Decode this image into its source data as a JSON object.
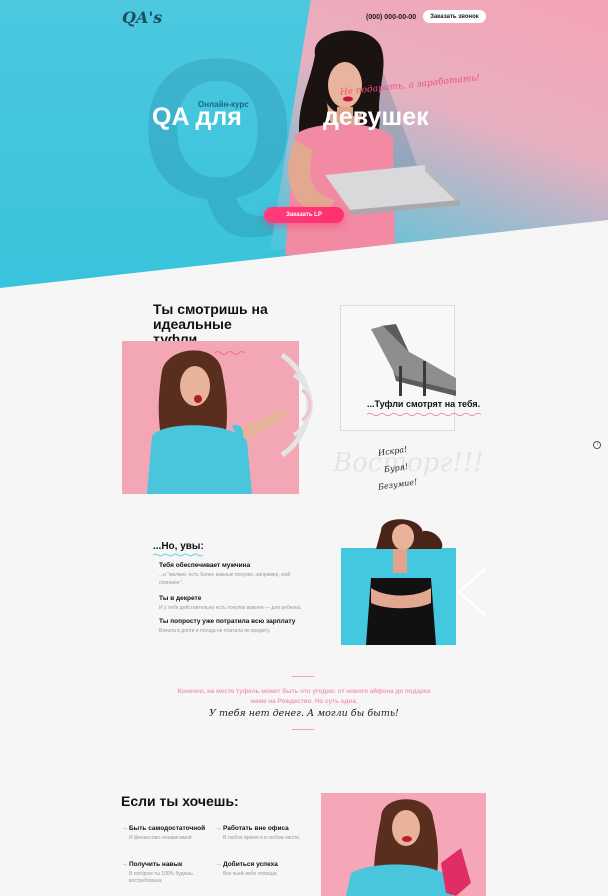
{
  "header": {
    "logo": "QA's",
    "phone": "(000) 000-00-00",
    "call_button": "Заказать звонок"
  },
  "hero": {
    "big_letters": "QA",
    "course_label": "Онлайн-курс",
    "title_left": "QA для",
    "title_right": "девушек",
    "tagline": "Не подарить, а заработать!",
    "cta": "Заказать LP"
  },
  "shoes_section": {
    "title": "Ты смотришь на идеальные туфли...",
    "caption": "...Туфли смотрят на тебя.",
    "words": [
      "Искра!",
      "Буря!",
      "Безумие!"
    ],
    "background_word": "Восторг!!!"
  },
  "but_section": {
    "title": "...Но, увы:",
    "items": [
      {
        "heading": "Тебя обеспечивает мужчина",
        "text": "...и \"мелкие, есть более важные покупки, например, мой спиннинг\"."
      },
      {
        "heading": "Ты в декрете",
        "text": "И у тебя действительно есть покупки важнее — для ребенка."
      },
      {
        "heading": "Ты попросту уже потратила всю зарплату",
        "text": "Влезла в долги и погода не платила по кредиту."
      }
    ]
  },
  "quote": {
    "pink_text": "Конечно, на месте туфель может быть что угодно: от нового айфона до подарка маме на Рождество. Но суть одна.",
    "script_text": "У тебя нет денег. А могли бы быть!"
  },
  "wish_section": {
    "title": "Если ты хочешь:",
    "items": [
      {
        "heading": "Быть самодостаточной",
        "text": "И финансово независимой."
      },
      {
        "heading": "Работать вне офиса",
        "text": "В любое время и в любом месте."
      },
      {
        "heading": "Получить навык",
        "text": "В котором ты 100% будешь востребована."
      },
      {
        "heading": "Добиться успеха",
        "text": "Без чьей-либо помощи."
      }
    ]
  },
  "colors": {
    "cyan": "#44c8df",
    "pink": "#f5a6b7",
    "accent": "#ff2f6b"
  }
}
